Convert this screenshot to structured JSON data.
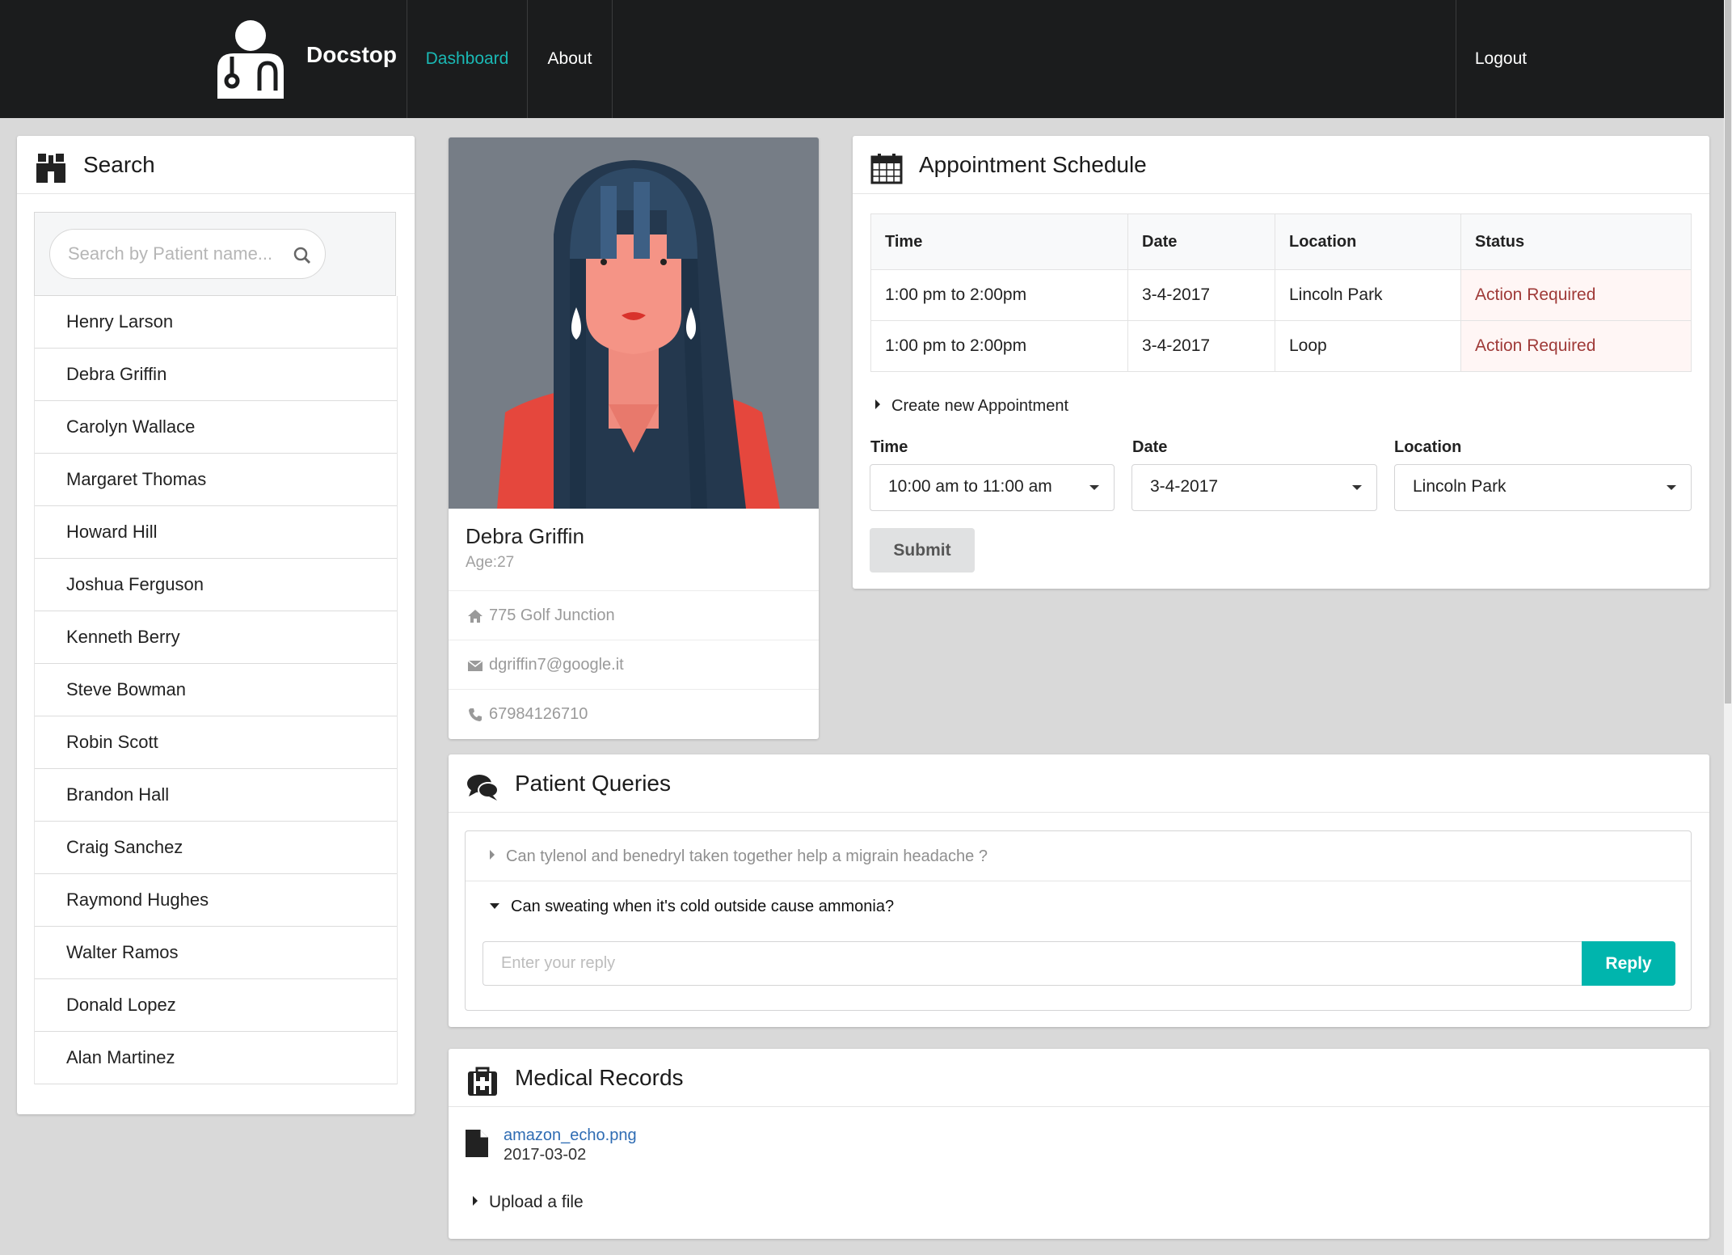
{
  "nav": {
    "brand": "Docstop",
    "items": [
      {
        "label": "Dashboard",
        "active": true
      },
      {
        "label": "About",
        "active": false
      }
    ],
    "logout": "Logout",
    "accent_color": "#1ab8b4"
  },
  "search": {
    "title": "Search",
    "placeholder": "Search by Patient name...",
    "patients": [
      "Henry Larson",
      "Debra Griffin",
      "Carolyn Wallace",
      "Margaret Thomas",
      "Howard Hill",
      "Joshua Ferguson",
      "Kenneth Berry",
      "Steve Bowman",
      "Robin Scott",
      "Brandon Hall",
      "Craig Sanchez",
      "Raymond Hughes",
      "Walter Ramos",
      "Donald Lopez",
      "Alan Martinez"
    ]
  },
  "profile": {
    "name": "Debra Griffin",
    "age": "Age:27",
    "address": "775 Golf Junction",
    "email": "dgriffin7@google.it",
    "phone": "67984126710"
  },
  "appointments": {
    "title": "Appointment Schedule",
    "columns": [
      "Time",
      "Date",
      "Location",
      "Status"
    ],
    "rows": [
      {
        "time": "1:00 pm to 2:00pm",
        "date": "3-4-2017",
        "location": "Lincoln Park",
        "status": "Action Required"
      },
      {
        "time": "1:00 pm to 2:00pm",
        "date": "3-4-2017",
        "location": "Loop",
        "status": "Action Required"
      }
    ],
    "create_label": "Create new Appointment",
    "form": {
      "time_label": "Time",
      "time_value": "10:00 am to 11:00 am",
      "date_label": "Date",
      "date_value": "3-4-2017",
      "location_label": "Location",
      "location_value": "Lincoln Park"
    },
    "submit": "Submit",
    "status_color": "#9f3a38"
  },
  "queries": {
    "title": "Patient Queries",
    "items": [
      {
        "text": "Can tylenol and benedryl taken together help a migrain headache ?",
        "expanded": false
      },
      {
        "text": "Can sweating when it's cold outside cause ammonia?",
        "expanded": true
      }
    ],
    "reply_placeholder": "Enter your reply",
    "reply_button": "Reply",
    "reply_color": "#00b5ad"
  },
  "records": {
    "title": "Medical Records",
    "files": [
      {
        "name": "amazon_echo.png",
        "date": "2017-03-02"
      }
    ],
    "upload_label": "Upload a file"
  }
}
